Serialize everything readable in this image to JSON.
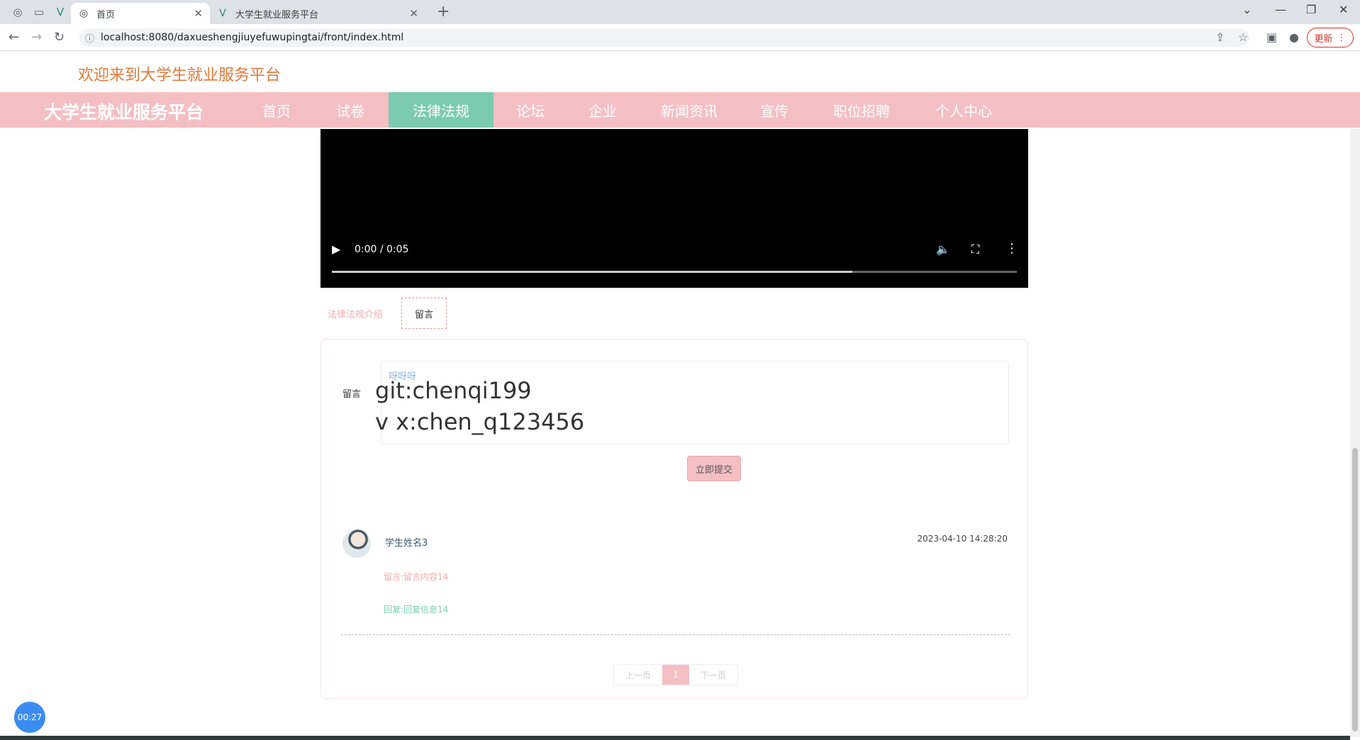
{
  "browser": {
    "tabs": [
      {
        "title": "首页",
        "active": true
      },
      {
        "title": "大学生就业服务平台",
        "active": false
      }
    ],
    "url": "localhost:8080/daxueshengjiuyefuwupingtai/front/index.html",
    "update_label": "更新"
  },
  "header": {
    "welcome": "欢迎来到大学生就业服务平台",
    "brand": "大学生就业服务平台"
  },
  "nav": {
    "items": [
      {
        "label": "首页"
      },
      {
        "label": "试卷"
      },
      {
        "label": "法律法规"
      },
      {
        "label": "论坛"
      },
      {
        "label": "企业"
      },
      {
        "label": "新闻资讯"
      },
      {
        "label": "宣传"
      },
      {
        "label": "职位招聘"
      },
      {
        "label": "个人中心"
      }
    ],
    "active_index": 2
  },
  "video": {
    "time": "0:00 / 0:05",
    "progress": 0.76
  },
  "detail_tabs": {
    "items": [
      {
        "label": "法律法规介绍"
      },
      {
        "label": "留言"
      }
    ],
    "active_index": 1
  },
  "comment_form": {
    "label": "留言",
    "input_value": "呀呀呀",
    "submit_label": "立即提交"
  },
  "overlay_text": {
    "line1": "git:chenqi199",
    "line2": "v x:chen_q123456"
  },
  "comments": [
    {
      "author": "学生姓名3",
      "time": "2023-04-10 14:28:20",
      "content": "留言:留言内容14",
      "reply": "回复:回复信息14"
    }
  ],
  "pager": {
    "prev": "上一页",
    "current": "1",
    "next": "下一页"
  },
  "timer": "00:27",
  "colors": {
    "navbar": "#f4bfc3",
    "nav_active": "#7ccbb0",
    "welcome": "#e07a39",
    "accent_pink": "#f4a9b1"
  }
}
